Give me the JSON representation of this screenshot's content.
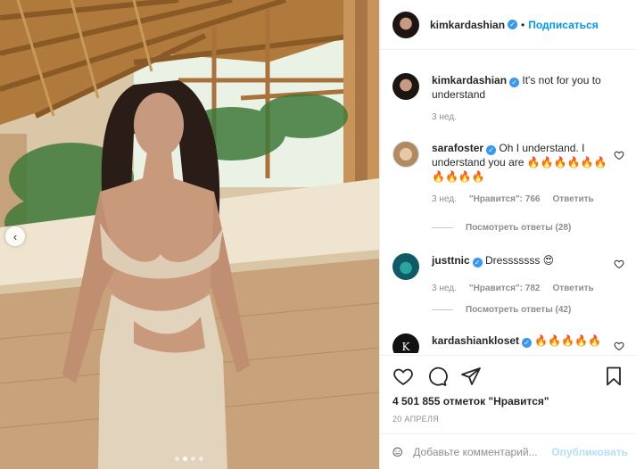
{
  "header": {
    "username": "kimkardashian",
    "verified": true,
    "separator": "•",
    "follow_label": "Подписаться"
  },
  "caption": {
    "username": "kimkardashian",
    "text": "It's not for you to understand",
    "time": "3 нед."
  },
  "comments": [
    {
      "username": "sarafoster",
      "text": "Oh I understand. I understand you are 🔥🔥🔥🔥🔥🔥🔥🔥🔥🔥",
      "time": "3 нед.",
      "likes": "\"Нравится\": 766",
      "reply_label": "Ответить",
      "view_replies": "Посмотреть ответы (28)"
    },
    {
      "username": "justtnic",
      "text": "Dresssssss 😍",
      "time": "3 нед.",
      "likes": "\"Нравится\": 782",
      "reply_label": "Ответить",
      "view_replies": "Посмотреть ответы (42)"
    },
    {
      "username": "kardashiankloset",
      "text": "🔥🔥🔥🔥🔥",
      "avatar_letter": "K"
    }
  ],
  "actions": {
    "icons": [
      "heart-icon",
      "comment-icon",
      "share-icon",
      "bookmark-icon"
    ],
    "likes_text": "4 501 855 отметок \"Нравится\"",
    "date": "20 АПРЕЛЯ"
  },
  "composer": {
    "placeholder": "Добавьте комментарий...",
    "post_label": "Опубликовать"
  },
  "carousel": {
    "prev_icon": "chevron-left-icon",
    "dots": 4,
    "active_dot": 1
  },
  "colors": {
    "accent": "#0095f6",
    "verified": "#3897f0",
    "muted": "#8e8e8e",
    "post_disabled": "#b2dffc"
  }
}
